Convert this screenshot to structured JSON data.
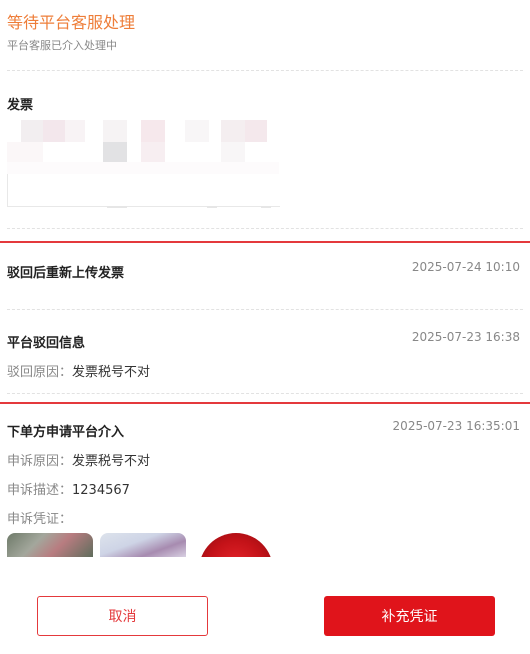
{
  "status": {
    "title": "等待平台客服处理",
    "subtitle": "平台客服已介入处理中"
  },
  "invoice": {
    "title": "发票"
  },
  "timeline": [
    {
      "title": "驳回后重新上传发票",
      "time": "2025-07-24 10:10"
    },
    {
      "title": "平台驳回信息",
      "time": "2025-07-23 16:38",
      "reason_label": "驳回原因：",
      "reason_value": "发票税号不对"
    },
    {
      "title": "下单方申请平台介入",
      "time": "2025-07-23 16:35:01",
      "reason_label": "申诉原因：",
      "reason_value": "发票税号不对",
      "desc_label": "申诉描述：",
      "desc_value": "1234567",
      "proof_label": "申诉凭证："
    }
  ],
  "buttons": {
    "cancel": "取消",
    "supplement": "补充凭证"
  },
  "colors": {
    "status_orange": "#ee7d38",
    "accent_red": "#e0141b"
  }
}
